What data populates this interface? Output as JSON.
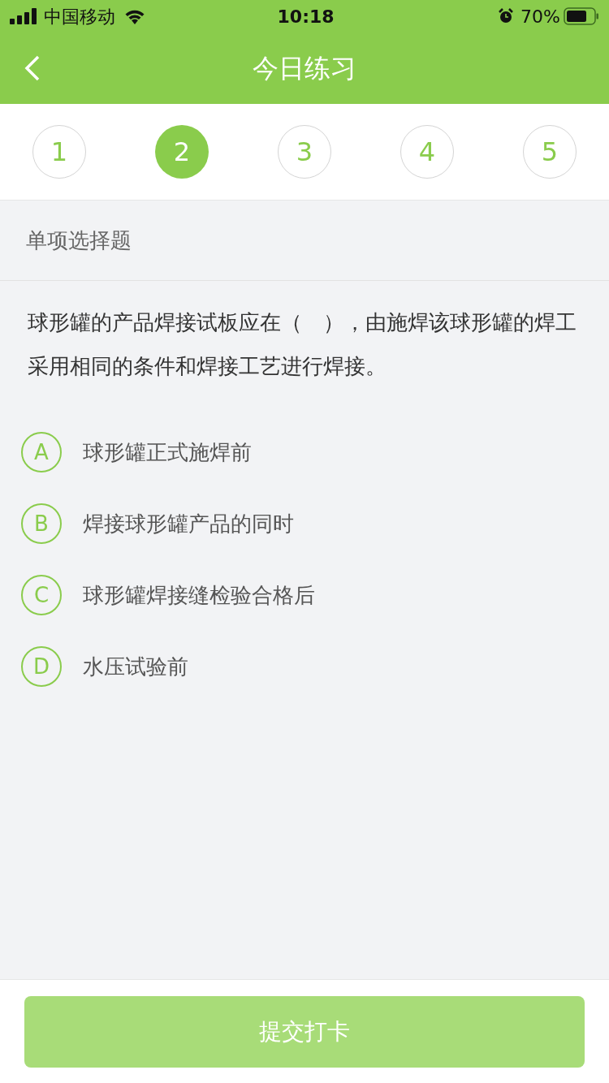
{
  "status_bar": {
    "carrier": "中国移动",
    "time": "10:18",
    "battery": "70%"
  },
  "nav": {
    "title": "今日练习"
  },
  "steps": [
    {
      "label": "1",
      "selected": false
    },
    {
      "label": "2",
      "selected": true
    },
    {
      "label": "3",
      "selected": false
    },
    {
      "label": "4",
      "selected": false
    },
    {
      "label": "5",
      "selected": false
    }
  ],
  "section": "单项选择题",
  "question": "球形罐的产品焊接试板应在（　），由施焊该球形罐的焊工采用相同的条件和焊接工艺进行焊接。",
  "options": [
    {
      "letter": "A",
      "text": "球形罐正式施焊前",
      "selected": false
    },
    {
      "letter": "B",
      "text": "焊接球形罐产品的同时",
      "selected": false
    },
    {
      "letter": "C",
      "text": "球形罐焊接缝检验合格后",
      "selected": false
    },
    {
      "letter": "D",
      "text": "水压试验前",
      "selected": false
    }
  ],
  "submit": {
    "label": "提交打卡",
    "disabled": true
  }
}
